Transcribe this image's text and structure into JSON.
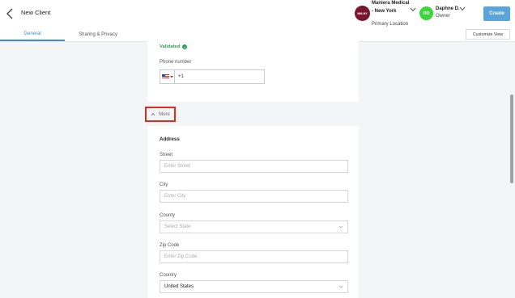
{
  "header": {
    "title": "New Client",
    "back_icon": "chevron-left-icon",
    "location": {
      "avatar_text": "MM-NY",
      "name": "Maniera Medical - New York",
      "sub": "Primary Location",
      "avatar_color": "#7a1730"
    },
    "user": {
      "avatar_text": "DD",
      "name": "Daphne D.",
      "role": "Owner",
      "avatar_color": "#3ed43e"
    },
    "create_label": "Create",
    "create_color": "#5aa4d8"
  },
  "tabs": [
    {
      "label": "General",
      "active": true
    },
    {
      "label": "Sharing & Privacy",
      "active": false
    }
  ],
  "customize_label": "Customize View",
  "contact": {
    "validated_label": "Validated",
    "phone_label": "Phone number",
    "country_flag": "us-flag-icon",
    "dial_code": "+1"
  },
  "more_label": "More",
  "address": {
    "title": "Address",
    "street": {
      "label": "Street",
      "placeholder": "Enter Street"
    },
    "city": {
      "label": "City",
      "placeholder": "Enter City"
    },
    "county": {
      "label": "County",
      "placeholder": "Select State"
    },
    "zip": {
      "label": "Zip Code",
      "placeholder": "Enter Zip Code"
    },
    "country": {
      "label": "Country",
      "value": "United States"
    }
  },
  "colors": {
    "accent": "#3a8fc7",
    "validated": "#2e9d5a",
    "highlight": "#e02a1f"
  }
}
